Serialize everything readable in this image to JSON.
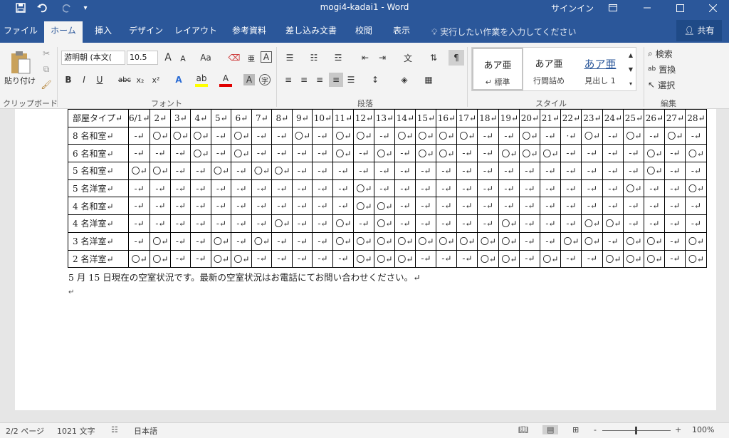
{
  "titlebar": {
    "title": "mogi4-kadai1  -  Word",
    "signin": "サインイン",
    "save_icon": "save-icon",
    "undo_icon": "undo-icon",
    "redo_icon": "redo-icon",
    "customize_icon": "customize-quick-access-icon",
    "ribbon_display_icon": "ribbon-display-icon",
    "minimize_icon": "minimize-icon",
    "maximize_icon": "maximize-icon",
    "close_icon": "close-icon"
  },
  "tabs": {
    "file": "ファイル",
    "home": "ホーム",
    "insert": "挿入",
    "design": "デザイン",
    "layout": "レイアウト",
    "references": "参考資料",
    "mailings": "差し込み文書",
    "review": "校閲",
    "view": "表示",
    "tellme": "実行したい作業を入力してください",
    "share": "共有"
  },
  "ribbon": {
    "clipboard": {
      "paste": "貼り付け",
      "label": "クリップボード"
    },
    "font": {
      "name": "游明朝 (本文(",
      "size": "10.5",
      "grow": "A",
      "shrink": "A",
      "case": "Aa",
      "bold": "B",
      "italic": "I",
      "underline": "U",
      "strike": "abc",
      "subscript": "x₂",
      "superscript": "x²",
      "label": "フォント"
    },
    "paragraph": {
      "label": "段落"
    },
    "styles": {
      "items": [
        {
          "preview": "あア亜",
          "name": "↵ 標準"
        },
        {
          "preview": "あア亜",
          "name": "行間詰め"
        },
        {
          "preview": "あア亜",
          "name": "見出し 1"
        }
      ],
      "label": "スタイル"
    },
    "editing": {
      "find": "検索",
      "replace": "置換",
      "select": "選択",
      "label": "編集"
    }
  },
  "document": {
    "table": {
      "header": [
        "部屋タイプ↵",
        "6/1↵",
        "2↵",
        "3↵",
        "4↵",
        "5↵",
        "6↵",
        "7↵",
        "8↵",
        "9↵",
        "10↵",
        "11↵",
        "12↵",
        "13↵",
        "14↵",
        "15↵",
        "16↵",
        "17↵",
        "18↵",
        "19↵",
        "20↵",
        "21↵",
        "22↵",
        "23↵",
        "24↵",
        "25↵",
        "26↵",
        "27↵",
        "28↵"
      ],
      "rows": [
        [
          "8 名和室↵",
          "-↵",
          "〇↵",
          "〇↵",
          "〇↵",
          "-↵",
          "〇↵",
          "-↵",
          "-↵",
          "〇↵",
          "-↵",
          "〇↵",
          "〇↵",
          "-↵",
          "〇↵",
          "〇↵",
          "〇↵",
          "〇↵",
          "-↵",
          "-↵",
          "〇↵",
          "-↵",
          "·↵",
          "〇↵",
          "-↵",
          "〇↵",
          "-↵",
          "〇↵",
          "-↵"
        ],
        [
          "6 名和室↵",
          "-↵",
          "-↵",
          "-↵",
          "〇↵",
          "-↵",
          "〇↵",
          "-↵",
          "-↵",
          "-↵",
          "-↵",
          "〇↵",
          "-↵",
          "〇↵",
          "-↵",
          "〇↵",
          "〇↵",
          "-↵",
          "-↵",
          "〇↵",
          "〇↵",
          "〇↵",
          "-↵",
          "-↵",
          "-↵",
          "-↵",
          "〇↵",
          "-↵",
          "〇↵"
        ],
        [
          "5 名和室↵",
          "〇↵",
          "〇↵",
          "-↵",
          "-↵",
          "〇↵",
          "-↵",
          "〇↵",
          "〇↵",
          "-↵",
          "-↵",
          "-↵",
          "-↵",
          "-↵",
          "-↵",
          "-↵",
          "-↵",
          "-↵",
          "-↵",
          "-↵",
          "-↵",
          "-↵",
          "-↵",
          "-↵",
          "-↵",
          "-↵",
          "〇↵",
          "-↵",
          "-↵"
        ],
        [
          "5 名洋室↵",
          "-↵",
          "-↵",
          "-↵",
          "-↵",
          "-↵",
          "-↵",
          "-↵",
          "-↵",
          "-↵",
          "-↵",
          "-↵",
          "〇↵",
          "-↵",
          "-↵",
          "-↵",
          "-↵",
          "-↵",
          "-↵",
          "-↵",
          "-↵",
          "-↵",
          "-↵",
          "-↵",
          "-↵",
          "〇↵",
          "-↵",
          "-↵",
          "〇↵"
        ],
        [
          "4 名和室↵",
          "-↵",
          "-↵",
          "-↵",
          "-↵",
          "-↵",
          "-↵",
          "-↵",
          "-↵",
          "-↵",
          "-↵",
          "-↵",
          "〇↵",
          "〇↵",
          "-↵",
          "-↵",
          "-↵",
          "-↵",
          "-↵",
          "-↵",
          "-↵",
          "-↵",
          "-↵",
          "-↵",
          "-↵",
          "-↵",
          "-↵",
          "-↵",
          "-↵"
        ],
        [
          "4 名洋室↵",
          "-↵",
          "-↵",
          "-↵",
          "-↵",
          "-↵",
          "-↵",
          "-↵",
          "〇↵",
          "-↵",
          "-↵",
          "〇↵",
          "-↵",
          "〇↵",
          "-↵",
          "-↵",
          "-↵",
          "-↵",
          "-↵",
          "〇↵",
          "-↵",
          "-↵",
          "-↵",
          "〇↵",
          "〇↵",
          "-↵",
          "-↵",
          "-↵",
          "-↵"
        ],
        [
          "3 名洋室↵",
          "-↵",
          "〇↵",
          "-↵",
          "-↵",
          "〇↵",
          "-↵",
          "〇↵",
          "-↵",
          "-↵",
          "-↵",
          "〇↵",
          "〇↵",
          "〇↵",
          "〇↵",
          "〇↵",
          "〇↵",
          "〇↵",
          "〇↵",
          "〇↵",
          "-↵",
          "-↵",
          "〇↵",
          "〇↵",
          "-↵",
          "〇↵",
          "〇↵",
          "-↵",
          "〇↵"
        ],
        [
          "2 名洋室↵",
          "〇↵",
          "〇↵",
          "-↵",
          "-↵",
          "〇↵",
          "〇↵",
          "-↵",
          "-↵",
          "-↵",
          "-↵",
          "-↵",
          "〇↵",
          "〇↵",
          "〇↵",
          "-↵",
          "-↵",
          "-↵",
          "〇↵",
          "〇↵",
          "-↵",
          "〇↵",
          "-↵",
          "-↵",
          "〇↵",
          "〇↵",
          "〇↵",
          "-↵",
          "〇↵"
        ]
      ]
    },
    "caption": "5 月 15 日現在の空室状況です。最新の空室状況はお電話にてお問い合わせください。↵",
    "empty_paragraph": "↵"
  },
  "statusbar": {
    "page": "2/2 ページ",
    "words": "1021 文字",
    "language": "日本語",
    "zoom": "100%",
    "minus": "-",
    "plus": "+"
  },
  "colors": {
    "accent": "#2b579a",
    "ribbon_bg": "#f3f3f3"
  }
}
